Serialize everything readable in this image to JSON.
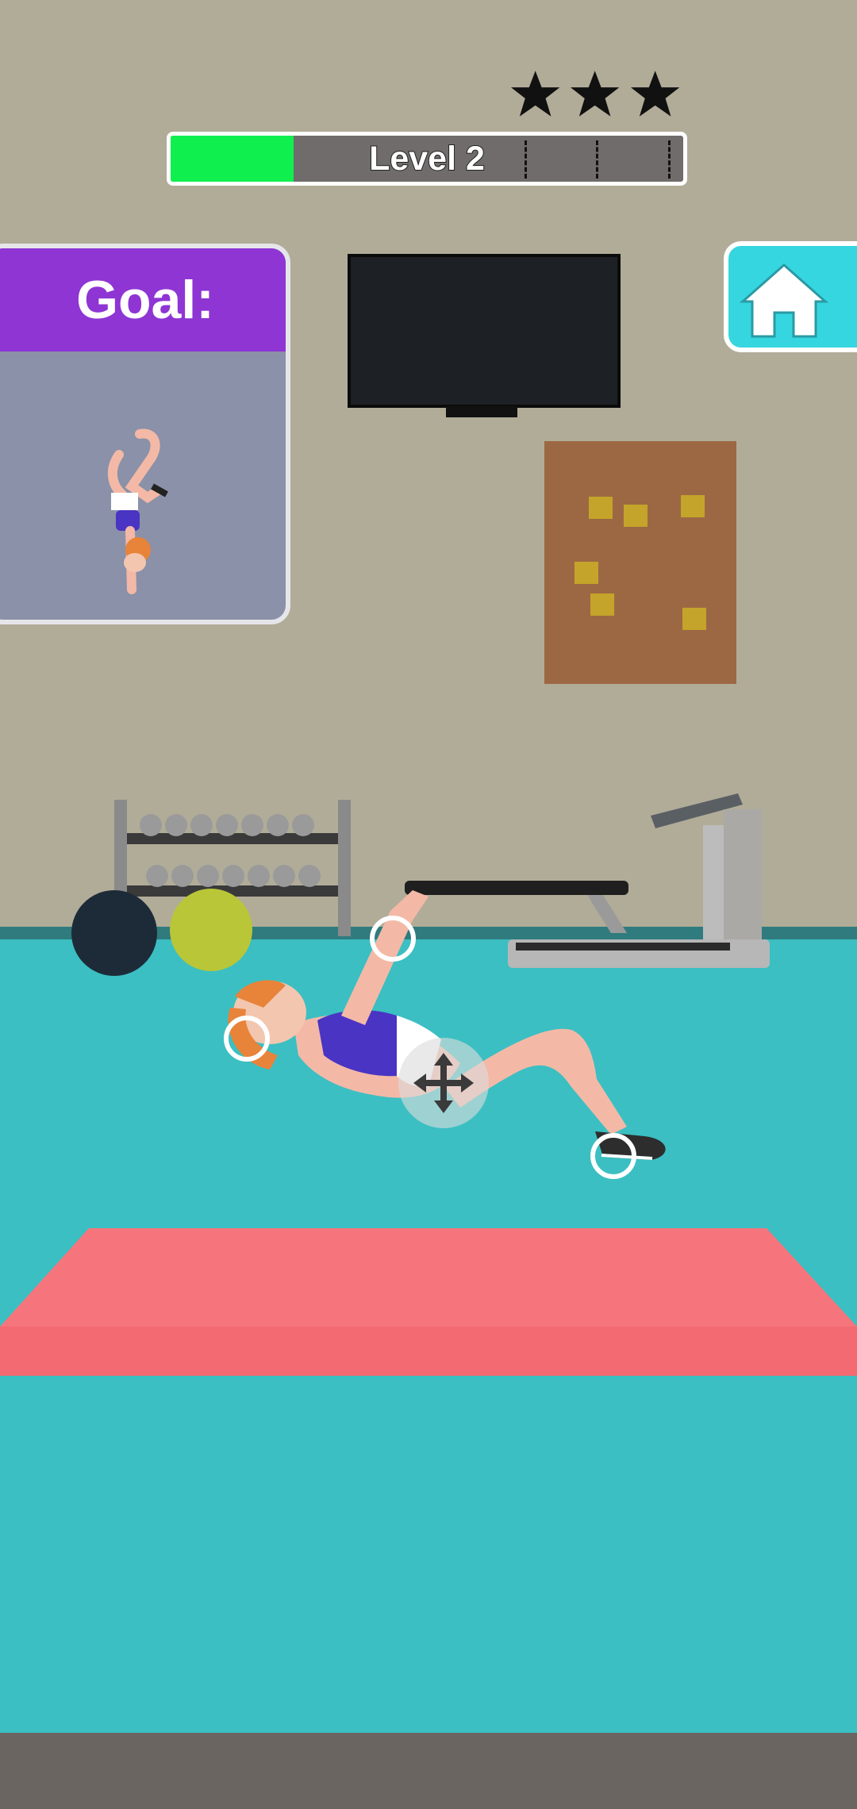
{
  "hud": {
    "stars": {
      "total": 3,
      "earned": 0,
      "icon": "star-icon"
    },
    "level": {
      "label": "Level 2",
      "progress": 0.24,
      "checkpoints": [
        0.69,
        0.83,
        0.97
      ],
      "fill_color": "#0ff04f",
      "track_color": "#6f6c6b"
    }
  },
  "goal_panel": {
    "title": "Goal:",
    "header_color": "#8e35d4"
  },
  "home_button": {
    "icon": "home-icon",
    "color": "#35d6e0"
  },
  "controls": {
    "limb_handles": [
      "head-handle",
      "hand-handle",
      "foot-handle"
    ],
    "move_handle_icon": "move-arrows-icon"
  },
  "colors": {
    "wall": "#b1ac98",
    "floor": "#3bbfc2",
    "mat": "#f36a73"
  }
}
